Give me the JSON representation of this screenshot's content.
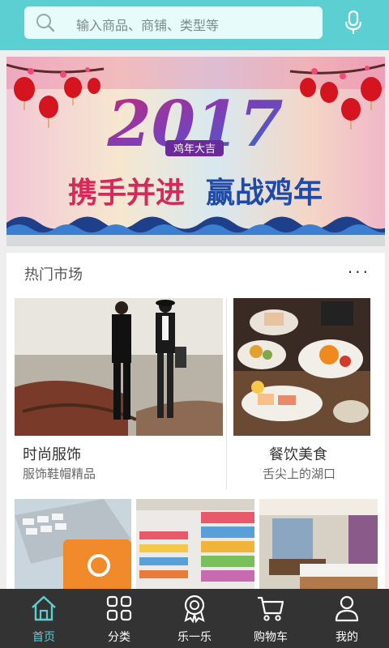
{
  "search": {
    "placeholder": "输入商品、商铺、类型等"
  },
  "banner": {
    "year": "2017",
    "tag": "鸡年大吉",
    "slogan_left": "携手并进",
    "slogan_right": "赢战鸡年"
  },
  "hot_market": {
    "title": "热门市场",
    "more": "···"
  },
  "cards": [
    {
      "title": "时尚服饰",
      "subtitle": "服饰鞋帽精品"
    },
    {
      "title": "餐饮美食",
      "subtitle": "舌尖上的湖口"
    }
  ],
  "tabs": [
    {
      "label": "首页",
      "icon": "home-icon",
      "active": true
    },
    {
      "label": "分类",
      "icon": "grid-icon",
      "active": false
    },
    {
      "label": "乐一乐",
      "icon": "badge-icon",
      "active": false
    },
    {
      "label": "购物车",
      "icon": "cart-icon",
      "active": false
    },
    {
      "label": "我的",
      "icon": "user-icon",
      "active": false
    }
  ],
  "colors": {
    "accent": "#5ccfd3",
    "tabbar": "#333333"
  }
}
